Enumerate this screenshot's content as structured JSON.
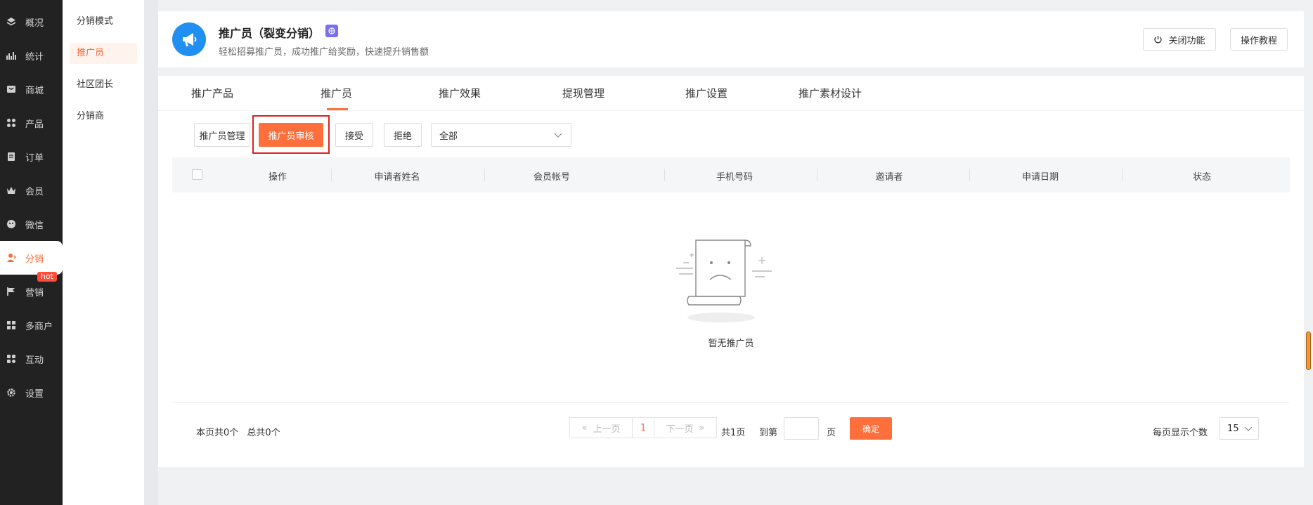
{
  "nav": {
    "items": [
      {
        "label": "概况",
        "icon": "layers-icon"
      },
      {
        "label": "统计",
        "icon": "chart-icon"
      },
      {
        "label": "商城",
        "icon": "shop-icon"
      },
      {
        "label": "产品",
        "icon": "grid-icon"
      },
      {
        "label": "订单",
        "icon": "order-icon"
      },
      {
        "label": "会员",
        "icon": "crown-icon"
      },
      {
        "label": "微信",
        "icon": "wechat-icon"
      },
      {
        "label": "分销",
        "icon": "distribution-icon"
      },
      {
        "label": "营销",
        "icon": "flag-icon"
      },
      {
        "label": "多商户",
        "icon": "multi-store-icon"
      },
      {
        "label": "互动",
        "icon": "interact-icon"
      },
      {
        "label": "设置",
        "icon": "gear-icon"
      }
    ],
    "active_index": 7,
    "hot_badge": "hot"
  },
  "subnav": {
    "items": [
      "分销模式",
      "推广员",
      "社区团长",
      "分销商"
    ],
    "active_index": 1
  },
  "header": {
    "title": "推广员（裂变分销）",
    "subtitle": "轻松招募推广员，成功推广给奖励，快速提升销售额",
    "close_feature": "关闭功能",
    "tutorial": "操作教程"
  },
  "tabs": [
    "推广产品",
    "推广员",
    "推广效果",
    "提现管理",
    "推广设置",
    "推广素材设计"
  ],
  "active_tab": 1,
  "toolbar": {
    "manage": "推广员管理",
    "review": "推广员审核",
    "accept": "接受",
    "reject": "拒绝",
    "filter_value": "全部"
  },
  "table": {
    "columns": [
      "操作",
      "申请者姓名",
      "会员帐号",
      "手机号码",
      "邀请者",
      "申请日期",
      "状态"
    ]
  },
  "empty": {
    "text": "暂无推广员"
  },
  "pagination": {
    "page_count_text": "本页共0个",
    "total_text": "总共0个",
    "prev": "上一页",
    "current": "1",
    "next": "下一页",
    "total_pages": "共1页",
    "goto_label": "到第",
    "page_unit": "页",
    "confirm": "确定",
    "per_page_label": "每页显示个数",
    "per_page_value": "15"
  },
  "colors": {
    "accent": "#ff6f3c",
    "nav_bg": "#222222",
    "highlight": "#e02020"
  }
}
